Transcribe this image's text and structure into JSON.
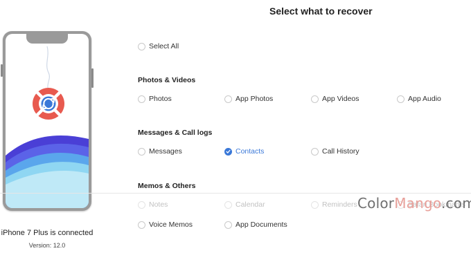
{
  "page": {
    "title": "Select what to recover"
  },
  "device": {
    "name": "iPhone 7 Plus is connected",
    "version": "Version: 12.0"
  },
  "select_all": {
    "label": "Select All",
    "checked": false
  },
  "sections": {
    "photos": {
      "title": "Photos & Videos",
      "options": [
        {
          "label": "Photos",
          "checked": false
        },
        {
          "label": "App Photos",
          "checked": false
        },
        {
          "label": "App Videos",
          "checked": false
        },
        {
          "label": "App Audio",
          "checked": false
        }
      ]
    },
    "messages": {
      "title": "Messages & Call logs",
      "options": [
        {
          "label": "Messages",
          "checked": false
        },
        {
          "label": "Contacts",
          "checked": true
        },
        {
          "label": "Call History",
          "checked": false
        }
      ]
    },
    "memos": {
      "title": "Memos & Others",
      "options": [
        {
          "label": "Notes",
          "checked": false
        },
        {
          "label": "Calendar",
          "checked": false
        },
        {
          "label": "Reminders",
          "checked": false
        },
        {
          "label": "Safari Bookmarks",
          "checked": false
        },
        {
          "label": "Voice Memos",
          "checked": false
        },
        {
          "label": "App Documents",
          "checked": false
        }
      ]
    }
  },
  "watermark": {
    "prefix": "Color",
    "accent": "Mango",
    "suffix": ".com"
  },
  "colors": {
    "accent": "#3a78d8",
    "logo_red": "#e85a4f",
    "wave_dark": "#4a3fd6",
    "wave_light": "#bfe9f7"
  },
  "icons": {
    "logo": "lifebuoy-icon",
    "check": "check-icon"
  }
}
